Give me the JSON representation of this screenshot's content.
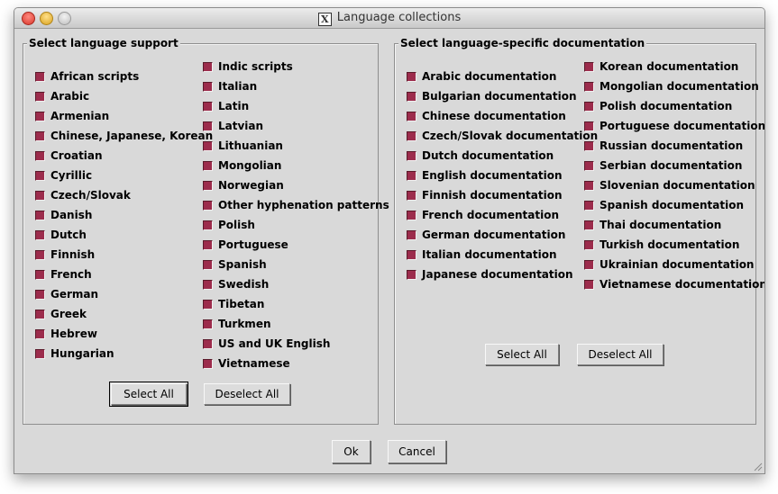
{
  "window": {
    "title": "Language collections",
    "title_icon": "x11-icon"
  },
  "language_support": {
    "title": "Select language support",
    "left_column": [
      "African scripts",
      "Arabic",
      "Armenian",
      "Chinese, Japanese, Korean",
      "Croatian",
      "Cyrillic",
      "Czech/Slovak",
      "Danish",
      "Dutch",
      "Finnish",
      "French",
      "German",
      "Greek",
      "Hebrew",
      "Hungarian"
    ],
    "right_column": [
      "Indic scripts",
      "Italian",
      "Latin",
      "Latvian",
      "Lithuanian",
      "Mongolian",
      "Norwegian",
      "Other hyphenation patterns",
      "Polish",
      "Portuguese",
      "Spanish",
      "Swedish",
      "Tibetan",
      "Turkmen",
      "US and UK English",
      "Vietnamese"
    ],
    "select_all": "Select All",
    "deselect_all": "Deselect All"
  },
  "documentation": {
    "title": "Select language-specific documentation",
    "left_column": [
      "Arabic documentation",
      "Bulgarian documentation",
      "Chinese documentation",
      "Czech/Slovak documentation",
      "Dutch documentation",
      "English documentation",
      "Finnish documentation",
      "French documentation",
      "German documentation",
      "Italian documentation",
      "Japanese documentation"
    ],
    "right_column": [
      "Korean documentation",
      "Mongolian documentation",
      "Polish documentation",
      "Portuguese documentation",
      "Russian documentation",
      "Serbian documentation",
      "Slovenian documentation",
      "Spanish documentation",
      "Thai documentation",
      "Turkish documentation",
      "Ukrainian documentation",
      "Vietnamese documentation"
    ],
    "select_all": "Select All",
    "deselect_all": "Deselect All"
  },
  "footer": {
    "ok": "Ok",
    "cancel": "Cancel"
  },
  "colors": {
    "checkbox_checked": "#9c2c4c",
    "window_bg": "#d9d9d9"
  }
}
